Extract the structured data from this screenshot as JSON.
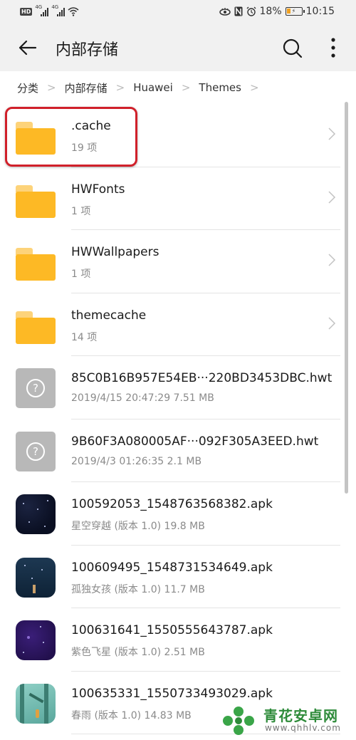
{
  "status_bar": {
    "hd_label": "HD",
    "network_1": "4G",
    "network_2": "4G",
    "battery_percent": "18%",
    "time": "10:15"
  },
  "app_bar": {
    "title": "内部存储"
  },
  "breadcrumb": [
    {
      "label": "分类"
    },
    {
      "label": "内部存储"
    },
    {
      "label": "Huawei"
    },
    {
      "label": "Themes"
    }
  ],
  "files": [
    {
      "type": "folder",
      "name": ".cache",
      "meta": "19 项",
      "highlighted": true
    },
    {
      "type": "folder",
      "name": "HWFonts",
      "meta": "1 项"
    },
    {
      "type": "folder",
      "name": "HWWallpapers",
      "meta": "1 项"
    },
    {
      "type": "folder",
      "name": "themecache",
      "meta": "14 项"
    },
    {
      "type": "unknown",
      "name": "85C0B16B957E54EB···220BD3453DBC.hwt",
      "meta": "2019/4/15 20:47:29 7.51 MB"
    },
    {
      "type": "unknown",
      "name": "9B60F3A080005AF···092F305A3EED.hwt",
      "meta": "2019/4/3 01:26:35 2.1 MB"
    },
    {
      "type": "apk",
      "name": "100592053_1548763568382.apk",
      "meta": "星空穿越 (版本 1.0) 19.8 MB"
    },
    {
      "type": "apk",
      "name": "100609495_1548731534649.apk",
      "meta": "孤独女孩 (版本 1.0) 11.7 MB"
    },
    {
      "type": "apk",
      "name": "100631641_1550555643787.apk",
      "meta": "紫色飞星 (版本 1.0) 2.51 MB"
    },
    {
      "type": "apk",
      "name": "100635331_1550733493029.apk",
      "meta": "春雨 (版本 1.0) 14.83 MB"
    }
  ],
  "watermark": {
    "title": "青花安卓网",
    "url": "www.qhhlv.com"
  },
  "colors": {
    "folder": "#fdb925",
    "highlight": "#d0202a",
    "watermark_green": "#2e8b3a"
  }
}
